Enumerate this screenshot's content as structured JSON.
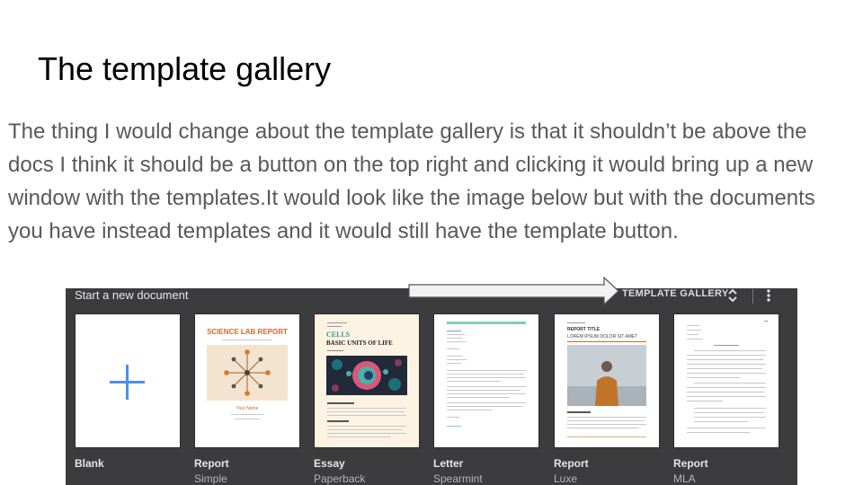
{
  "slide": {
    "title": "The template gallery",
    "body": "The thing I would change about the template gallery is that it shouldn’t be above the docs I think it should be a button on the top right and clicking it would bring up a new window with the templates.It would look like the image below but with the documents you have instead templates and it would still have the template button."
  },
  "gallery": {
    "title": "Start a new document",
    "template_button": "TEMPLATE GALLERY",
    "icons": [
      "unfold-icon",
      "more-vert-icon",
      "arrow-right-icon",
      "plus-icon"
    ],
    "accent_blue": "#4a8ef0",
    "background": "#3c3c3e",
    "templates": [
      {
        "label": "Blank",
        "sublabel": ""
      },
      {
        "label": "Report",
        "sublabel": "Simple"
      },
      {
        "label": "Essay",
        "sublabel": "Paperback"
      },
      {
        "label": "Letter",
        "sublabel": "Spearmint"
      },
      {
        "label": "Report",
        "sublabel": "Luxe"
      },
      {
        "label": "Report",
        "sublabel": "MLA"
      }
    ]
  },
  "thumbs": {
    "simple_title": "SCIENCE LAB REPORT",
    "simple_author": "Your Name",
    "paperback_line1": "CELLS",
    "paperback_line2": "BASIC UNITS OF LIFE",
    "luxe_title": "REPORT TITLE",
    "luxe_subtitle": "LOREM IPSUM DOLOR SIT AMET"
  }
}
